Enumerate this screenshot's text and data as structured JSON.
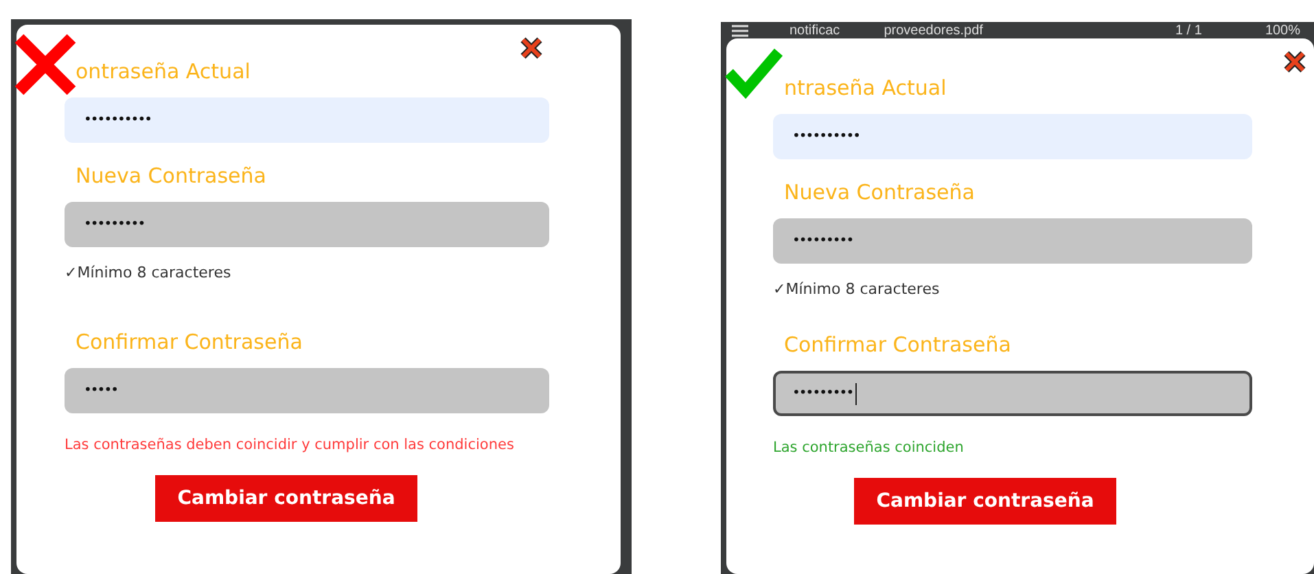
{
  "panels": [
    {
      "correct": false,
      "dialog": {
        "fields": [
          {
            "label": "ontraseña Actual",
            "value": "••••••••••",
            "autofilled": true,
            "focused": false
          },
          {
            "label": "Nueva Contraseña",
            "value": "•••••••••",
            "autofilled": false,
            "focused": false
          },
          {
            "label": "Confirmar Contraseña",
            "value": "•••••",
            "autofilled": false,
            "focused": false
          }
        ],
        "hint": "✓Mínimo 8 caracteres",
        "message": {
          "text": "Las contraseñas deben coincidir y cumplir con las condiciones",
          "valid": false
        },
        "button": "Cambiar contraseña"
      }
    },
    {
      "correct": true,
      "viewer": {
        "file_name": "notificac",
        "file_name_rest": "proveedores.pdf",
        "page": "1 / 1",
        "zoom": "100%"
      },
      "dialog": {
        "fields": [
          {
            "label": "ntraseña Actual",
            "value": "••••••••••",
            "autofilled": true,
            "focused": false
          },
          {
            "label": "Nueva Contraseña",
            "value": "•••••••••",
            "autofilled": false,
            "focused": false
          },
          {
            "label": "Confirmar Contraseña",
            "value": "•••••••••",
            "autofilled": false,
            "focused": true
          }
        ],
        "hint": "✓Mínimo 8 caracteres",
        "message": {
          "text": "Las contraseñas coinciden",
          "valid": true
        },
        "button": "Cambiar contraseña"
      }
    }
  ]
}
